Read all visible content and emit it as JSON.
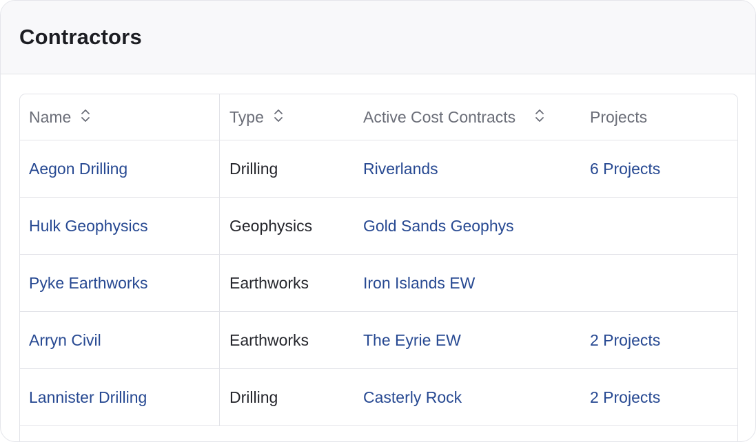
{
  "page": {
    "title": "Contractors"
  },
  "table": {
    "columns": [
      {
        "label": "Name",
        "sortable": true,
        "icon": "sort-icon"
      },
      {
        "label": "Type",
        "sortable": true,
        "icon": "sort-icon"
      },
      {
        "label": "Active Cost Contracts",
        "sortable": true,
        "icon": "sort-icon"
      },
      {
        "label": "Projects",
        "sortable": false
      }
    ],
    "rows": [
      {
        "name": "Aegon Drilling",
        "type": "Drilling",
        "contract": "Riverlands",
        "projects": "6 Projects"
      },
      {
        "name": "Hulk Geophysics",
        "type": "Geophysics",
        "contract": "Gold Sands Geophys",
        "projects": ""
      },
      {
        "name": "Pyke Earthworks",
        "type": "Earthworks",
        "contract": "Iron Islands EW",
        "projects": ""
      },
      {
        "name": "Arryn Civil",
        "type": "Earthworks",
        "contract": "The Eyrie EW",
        "projects": "2 Projects"
      },
      {
        "name": "Lannister Drilling",
        "type": "Drilling",
        "contract": "Casterly Rock",
        "projects": "2 Projects"
      }
    ]
  },
  "colors": {
    "link": "#274992",
    "text": "#24252b",
    "header_text": "#6b6e78",
    "border": "#e2e3e8"
  }
}
